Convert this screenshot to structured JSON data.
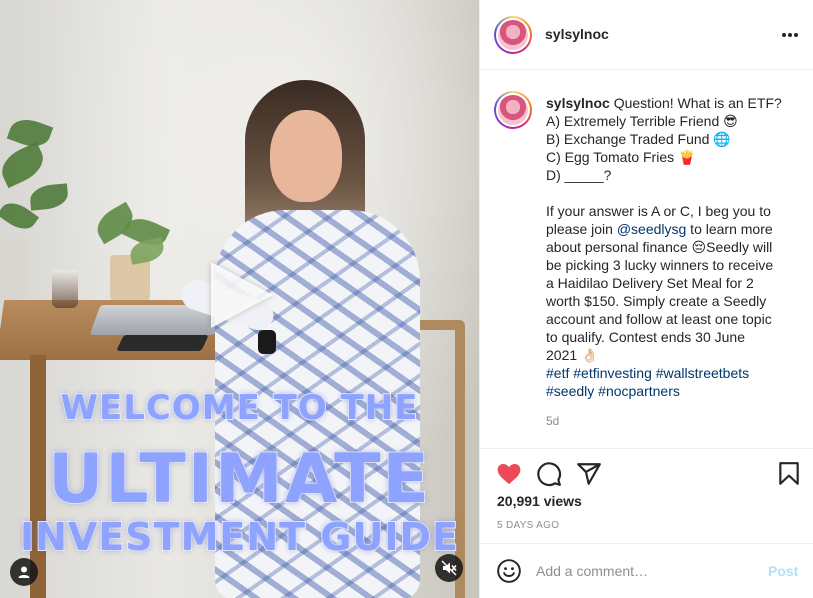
{
  "post": {
    "username": "sylsylnoc",
    "caption_lines": [
      "Question! What is an ETF?",
      "A) Extremely Terrible Friend 😎",
      "B) Exchange Traded Fund 🌐",
      "C) Egg Tomato Fries 🍟",
      "D) _____?"
    ],
    "body_lines": {
      "l1": "If your answer is A or C, I beg you to",
      "l2_before": "please join ",
      "l2_mention": "@seedlysg",
      "l2_after": " to learn more",
      "l3": "about personal finance 😔Seedly will",
      "l4": "be picking 3 lucky winners to receive",
      "l5": "a Haidilao Delivery Set Meal for 2",
      "l6": "worth $150. Simply create a Seedly",
      "l7": "account and follow at least one topic",
      "l8": "to qualify. Contest ends 30 June",
      "l9": "2021 👌🏻"
    },
    "hashtags_line1": [
      "#etf",
      "#etfinvesting",
      "#wallstreetbets"
    ],
    "hashtags_line2": [
      "#seedly",
      "#nocpartners"
    ],
    "time_ago": "5d",
    "views": "20,991 views",
    "date": "5 DAYS AGO"
  },
  "media": {
    "overlay_line1": "WELCOME TO THE",
    "overlay_line2": "ULTIMATE",
    "overlay_line3": "INVESTMENT GUIDE",
    "icons": [
      "play-icon",
      "user-icon",
      "mute-icon"
    ]
  },
  "comment": {
    "placeholder": "Add a comment…",
    "post_label": "Post"
  },
  "colors": {
    "like": "#ed4956",
    "link": "#00376b",
    "post_disabled": "#b2dffc",
    "overlay_text": "#8ea2ff"
  }
}
